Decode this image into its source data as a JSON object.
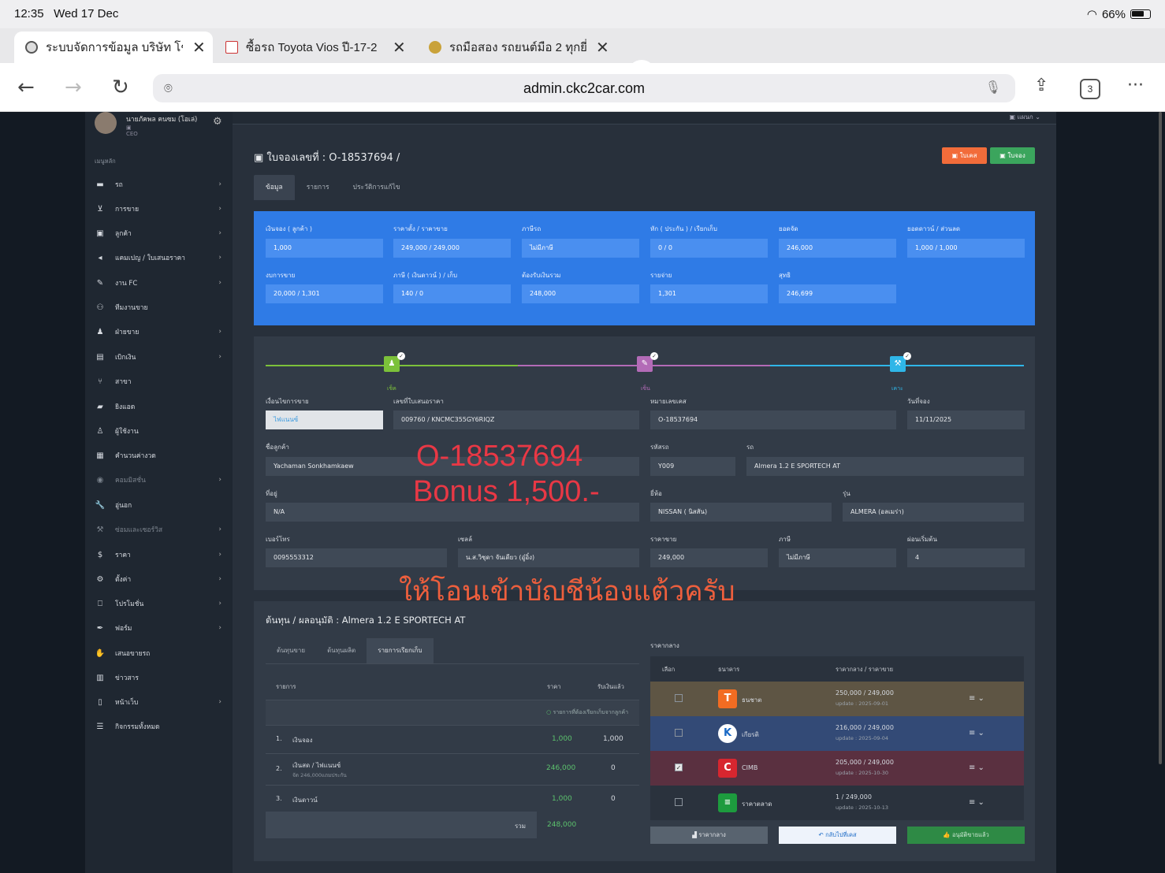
{
  "status": {
    "time": "12:35",
    "date": "Wed 17 Dec",
    "battery": "66%"
  },
  "browser": {
    "tabs": [
      {
        "title": "ระบบจัดการข้อมูล บริษัท โช"
      },
      {
        "title": "ซื้อรถ Toyota Vios ปี-17-2"
      },
      {
        "title": "รถมือสอง รถยนต์มือ 2 ทุกยี่"
      }
    ],
    "url": "admin.ckc2car.com",
    "tab_count": "3"
  },
  "profile": {
    "name": "นายภัคพล คนซม (โอเล่)",
    "role": "CEO"
  },
  "top_strip": "แผนก",
  "sidebar": {
    "header": "เมนูหลัก",
    "items": [
      {
        "label": "รถ"
      },
      {
        "label": "การขาย"
      },
      {
        "label": "ลูกค้า"
      },
      {
        "label": "แคมเปญ / ใบเสนอราคา"
      },
      {
        "label": "งาน FC"
      },
      {
        "label": "ทีมงานขาย"
      },
      {
        "label": "ฝ่ายขาย"
      },
      {
        "label": "เบิกเงิน"
      },
      {
        "label": "สาขา"
      },
      {
        "label": "ยิงแอด"
      },
      {
        "label": "ผู้ใช้งาน"
      },
      {
        "label": "คำนวนค่างวด"
      },
      {
        "label": "คอมมิสชั่น"
      },
      {
        "label": "อู่นอก"
      },
      {
        "label": "ซ่อมและเซอร์วิส"
      },
      {
        "label": "ราคา"
      },
      {
        "label": "ตั้งค่า"
      },
      {
        "label": "โปรโมชั่น"
      },
      {
        "label": "ฟอร์ม"
      },
      {
        "label": "เสนอขายรถ"
      },
      {
        "label": "ข่าวสาร"
      },
      {
        "label": "หน้าเว็บ"
      },
      {
        "label": "กิจกรรมทั้งหมด"
      }
    ]
  },
  "header": {
    "title": "ใบจองเลขที่ : O-18537694 /",
    "btn_case": "ใบเคส",
    "btn_booking": "ใบจอง"
  },
  "tabs1": [
    "ข้อมูล",
    "รายการ",
    "ประวัติการแก้ไข"
  ],
  "summary": {
    "fields": [
      {
        "label": "เงินจอง ( ลูกค้า )",
        "value": "1,000"
      },
      {
        "label": "ราคาตั้ง / ราคาขาย",
        "value": "249,000 / 249,000"
      },
      {
        "label": "ภาษีรถ",
        "value": "ไม่มีภาษี"
      },
      {
        "label": "หัก ( ประกัน ) / เรียกเก็บ",
        "value": "0 / 0"
      },
      {
        "label": "ยอดจัด",
        "value": "246,000"
      },
      {
        "label": "ยอดดาวน์ / ส่วนลด",
        "value": "1,000 / 1,000"
      },
      {
        "label": "งบการขาย",
        "value": "20,000 / 1,301"
      },
      {
        "label": "ภาษี ( เงินดาวน์ ) / เก็บ",
        "value": "140 / 0"
      },
      {
        "label": "ต้องรับเงินรวม",
        "value": "248,000"
      },
      {
        "label": "รายจ่าย",
        "value": "1,301"
      },
      {
        "label": "สุทธิ",
        "value": "246,699"
      }
    ]
  },
  "steps": [
    {
      "label": "เช็ค"
    },
    {
      "label": "เซ็น"
    },
    {
      "label": "เคาะ"
    }
  ],
  "details": {
    "sale_condition": {
      "label": "เงื่อนไขการขาย",
      "value": "ไฟแนนซ์"
    },
    "quote_no": {
      "label": "เลขที่ใบเสนอราคา",
      "value": "009760 / KNCMC355GY6RIQZ"
    },
    "case_no": {
      "label": "หมายเลขเคส",
      "value": "O-18537694"
    },
    "booking_date": {
      "label": "วันที่จอง",
      "value": "11/11/2025"
    },
    "customer": {
      "label": "ชื่อลูกค้า",
      "value": "Yachaman Sonkhamkaew"
    },
    "car_code": {
      "label": "รหัสรถ",
      "value": "Y009"
    },
    "car": {
      "label": "รถ",
      "value": "Almera 1.2 E SPORTECH AT"
    },
    "address": {
      "label": "ที่อยู่",
      "value": "N/A"
    },
    "brand": {
      "label": "ยี่ห้อ",
      "value": "NISSAN ( นิสสัน)"
    },
    "model": {
      "label": "รุ่น",
      "value": "ALMERA (อลเมร่า)"
    },
    "phone": {
      "label": "เบอร์โทร",
      "value": "0095553312"
    },
    "sales": {
      "label": "เซลล์",
      "value": "น.ส.วิชุดา จันเดียว (อู๋อิ๋ง)"
    },
    "price": {
      "label": "ราคาขาย",
      "value": "249,000"
    },
    "tax": {
      "label": "ภาษี",
      "value": "ไม่มีภาษี"
    },
    "installment": {
      "label": "ผ่อนเริ่มต้น",
      "value": "4"
    }
  },
  "overlay": {
    "line1": "O-18537694",
    "line2": "Bonus 1,500.-",
    "line3": "ให้โอนเข้าบัญชีน้องแต้วครับ"
  },
  "cost": {
    "title": "ต้นทุน / ผลอนุมัติ : Almera 1.2 E SPORTECH AT",
    "tabs": [
      "ต้นทุนขาย",
      "ต้นทุนผลิต",
      "รายการเรียกเก็บ"
    ],
    "headers": {
      "item": "รายการ",
      "price": "ราคา",
      "received": "รับเงินแล้ว"
    },
    "note": "รายการที่ต้องเรียกเก็บจากลูกค้า",
    "rows": [
      {
        "no": "1.",
        "name": "เงินจอง",
        "sub": "",
        "price": "1,000",
        "received": "1,000"
      },
      {
        "no": "2.",
        "name": "เงินสด / ไฟแนนซ์",
        "sub": "จัด 246,000แถมประกัน",
        "price": "246,000",
        "received": "0"
      },
      {
        "no": "3.",
        "name": "เงินดาวน์",
        "sub": "",
        "price": "1,000",
        "received": "0"
      }
    ],
    "total_label": "รวม",
    "total": "248,000"
  },
  "banks": {
    "title": "ราคากลาง",
    "headers": {
      "select": "เลือก",
      "bank": "ธนาคาร",
      "price": "ราคากลาง / ราคาขาย"
    },
    "rows": [
      {
        "name": "ธนชาต",
        "price": "250,000 / 249,000",
        "update": "update : 2025-09-01",
        "checked": false,
        "color": "#5e5544",
        "logo_color": "#f26c22",
        "logo": "T"
      },
      {
        "name": "เกียรติ",
        "price": "216,000 / 249,000",
        "update": "update : 2025-09-04",
        "checked": false,
        "color": "#334a76",
        "logo_color": "#ffffff",
        "logo": "K"
      },
      {
        "name": "CIMB",
        "price": "205,000 / 249,000",
        "update": "update : 2025-10-30",
        "checked": true,
        "color": "#5a3040",
        "logo_color": "#d7262f",
        "logo": "C"
      },
      {
        "name": "ราคาตลาด",
        "price": "1 / 249,000",
        "update": "update : 2025-10-13",
        "checked": false,
        "color": "#2a323d",
        "logo_color": "#1d9b3e",
        "logo": "≡"
      }
    ],
    "buttons": {
      "mid": "ราคากลาง",
      "back": "กลับไปที่เคส",
      "approve": "อนุมัติขายแล้ว"
    }
  }
}
